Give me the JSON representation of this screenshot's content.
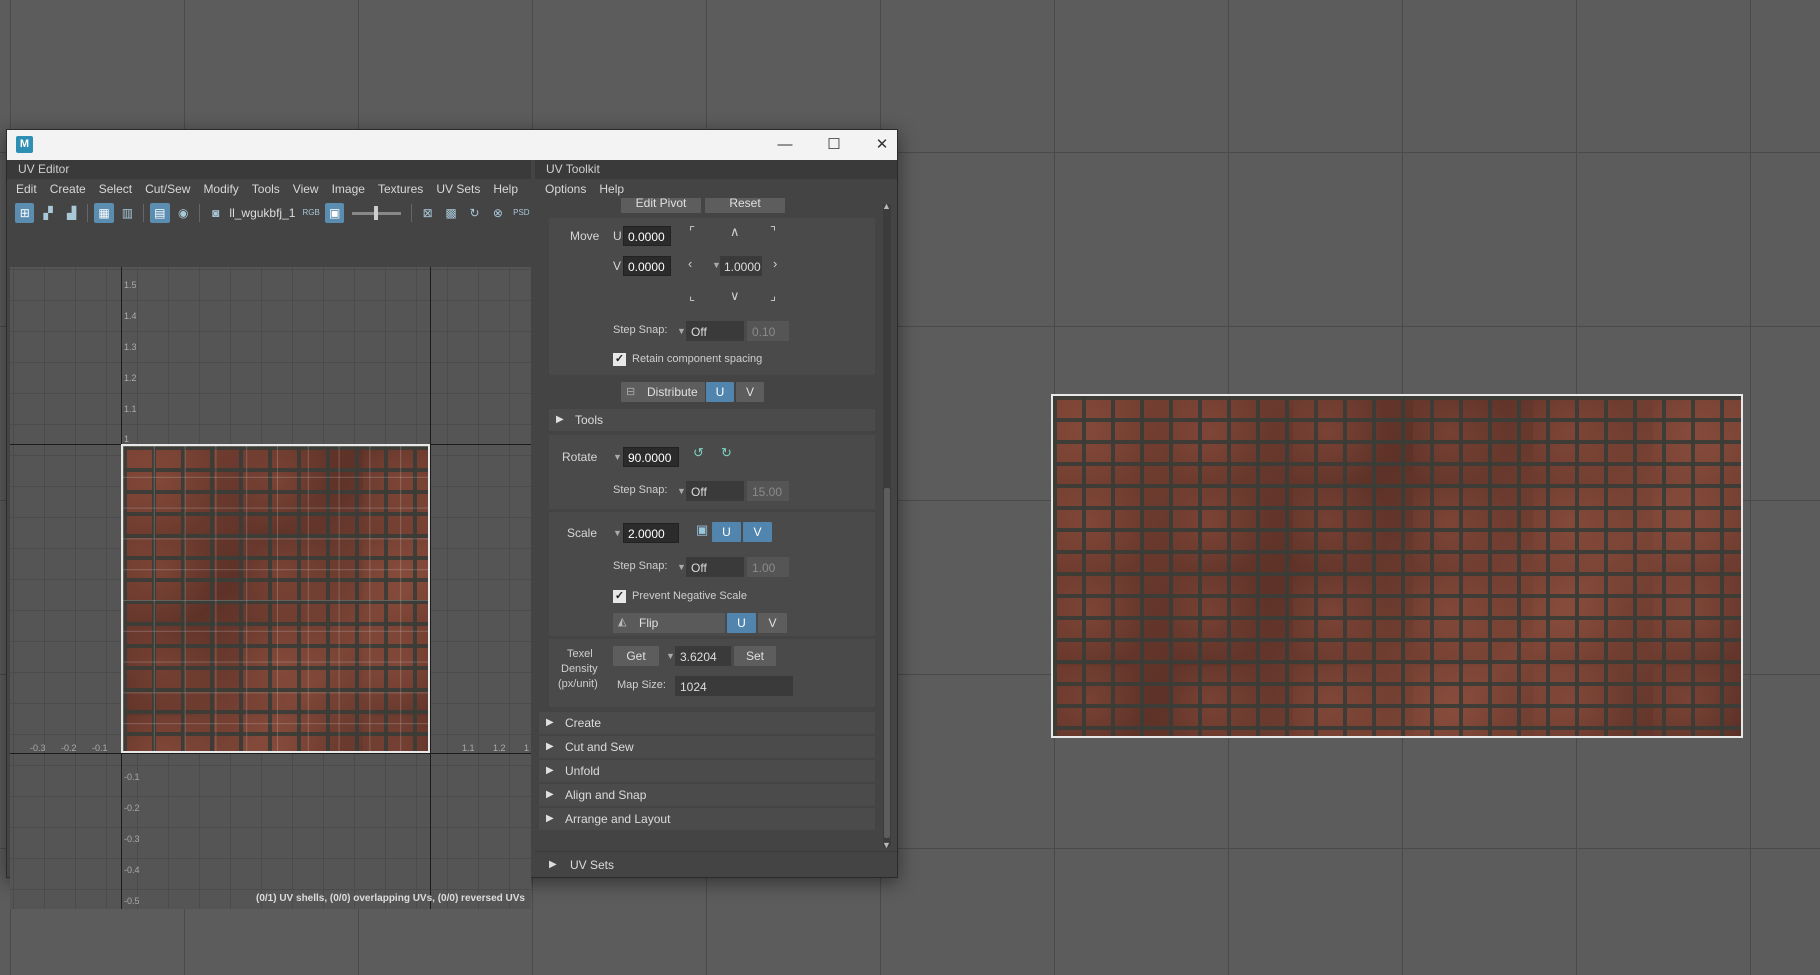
{
  "window": {
    "app_icon": "M",
    "controls": [
      "—",
      "☐",
      "✕"
    ]
  },
  "uv_editor": {
    "title": "UV Editor",
    "menu": [
      "Edit",
      "Create",
      "Select",
      "Cut/Sew",
      "Modify",
      "Tools",
      "View",
      "Image",
      "Textures",
      "UV Sets",
      "Help"
    ],
    "image_name": "ll_wgukbfj_1",
    "rgb_label": "RGB",
    "psd_label": "PSD",
    "ticks_v": [
      "1.5",
      "1.4",
      "1.3",
      "1.2",
      "1.1",
      "1",
      "-0.1",
      "-0.2",
      "-0.3",
      "-0.4",
      "-0.5"
    ],
    "ticks_h": [
      "-0.3",
      "-0.2",
      "-0.1",
      "1.1",
      "1.2",
      "1"
    ],
    "status": "(0/1) UV shells, (0/0) overlapping UVs, (0/0) reversed UVs"
  },
  "toolkit": {
    "title": "UV Toolkit",
    "menu": [
      "Options",
      "Help"
    ],
    "edit_pivot": "Edit Pivot",
    "reset": "Reset",
    "move": {
      "label": "Move",
      "u_label": "U",
      "u_value": "0.0000",
      "v_label": "V",
      "v_value": "0.0000",
      "step_value": "1.0000",
      "step_snap_label": "Step Snap:",
      "step_snap_mode": "Off",
      "step_snap_value": "0.10",
      "retain_label": "Retain component spacing",
      "distribute_label": "Distribute",
      "u_btn": "U",
      "v_btn": "V"
    },
    "tools_label": "Tools",
    "rotate": {
      "label": "Rotate",
      "value": "90.0000",
      "step_snap_label": "Step Snap:",
      "step_snap_mode": "Off",
      "step_snap_value": "15.00"
    },
    "scale": {
      "label": "Scale",
      "value": "2.0000",
      "u_btn": "U",
      "v_btn": "V",
      "step_snap_label": "Step Snap:",
      "step_snap_mode": "Off",
      "step_snap_value": "1.00",
      "prevent_label": "Prevent Negative Scale",
      "flip_label": "Flip",
      "flip_u": "U",
      "flip_v": "V"
    },
    "texel": {
      "label_line1": "Texel",
      "label_line2": "Density",
      "label_line3": "(px/unit)",
      "get": "Get",
      "value": "3.6204",
      "set": "Set",
      "map_size_label": "Map Size:",
      "map_size": "1024"
    },
    "sections": [
      "Create",
      "Cut and Sew",
      "Unfold",
      "Align and Snap",
      "Arrange and Layout"
    ],
    "uv_sets": "UV Sets"
  }
}
